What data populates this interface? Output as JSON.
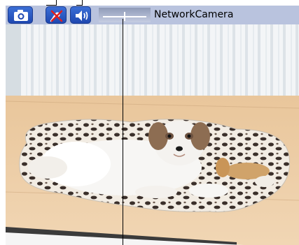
{
  "toolbar": {
    "camera_name": "NetworkCamera",
    "buttons": [
      {
        "name": "snapshot",
        "icon": "camera-icon"
      },
      {
        "name": "microphone",
        "icon": "microphone-muted-icon"
      },
      {
        "name": "speaker",
        "icon": "speaker-icon"
      }
    ],
    "volume": 0.5,
    "colors": {
      "bar": "#b9c3de",
      "button": "#2552c0"
    }
  },
  "camera_view": {
    "scene": "photo-dog-on-rug"
  }
}
